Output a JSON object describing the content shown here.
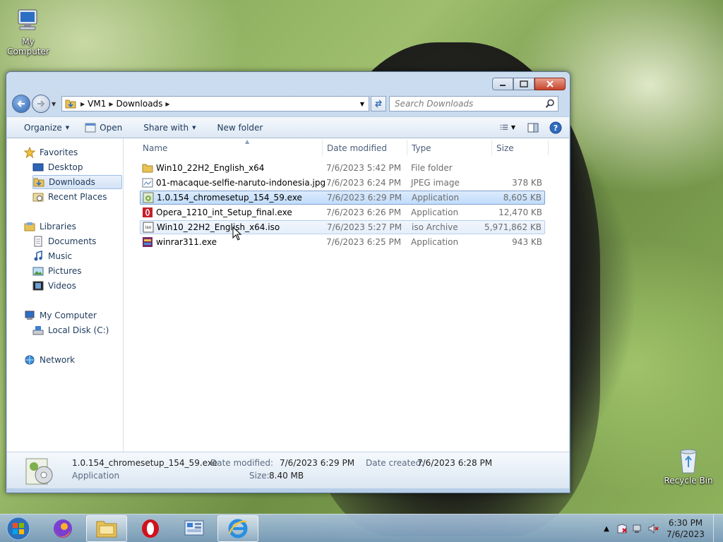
{
  "desktop": {
    "icons": [
      {
        "label": "My Computer"
      },
      {
        "label": "Recycle Bin"
      }
    ]
  },
  "window": {
    "address": {
      "crumbs": [
        "VM1",
        "Downloads"
      ]
    },
    "search_placeholder": "Search Downloads",
    "toolbar": {
      "organize": "Organize",
      "open": "Open",
      "share_with": "Share with",
      "new_folder": "New folder"
    },
    "nav": {
      "favorites": "Favorites",
      "desktop": "Desktop",
      "downloads": "Downloads",
      "recent_places": "Recent Places",
      "libraries": "Libraries",
      "documents": "Documents",
      "music": "Music",
      "pictures": "Pictures",
      "videos": "Videos",
      "my_computer": "My Computer",
      "local_disk": "Local Disk (C:)",
      "network": "Network"
    },
    "columns": {
      "name": "Name",
      "date": "Date modified",
      "type": "Type",
      "size": "Size"
    },
    "files": [
      {
        "name": "Win10_22H2_English_x64",
        "date": "7/6/2023 5:42 PM",
        "type": "File folder",
        "size": ""
      },
      {
        "name": "01-macaque-selfie-naruto-indonesia.jpg",
        "date": "7/6/2023 6:24 PM",
        "type": "JPEG image",
        "size": "378 KB"
      },
      {
        "name": "1.0.154_chromesetup_154_59.exe",
        "date": "7/6/2023 6:29 PM",
        "type": "Application",
        "size": "8,605 KB"
      },
      {
        "name": "Opera_1210_int_Setup_final.exe",
        "date": "7/6/2023 6:26 PM",
        "type": "Application",
        "size": "12,470 KB"
      },
      {
        "name": "Win10_22H2_English_x64.iso",
        "date": "7/6/2023 5:27 PM",
        "type": "iso Archive",
        "size": "5,971,862 KB"
      },
      {
        "name": "winrar311.exe",
        "date": "7/6/2023 6:25 PM",
        "type": "Application",
        "size": "943 KB"
      }
    ],
    "details": {
      "filename": "1.0.154_chromesetup_154_59.exe",
      "type": "Application",
      "date_modified_label": "Date modified:",
      "date_modified": "7/6/2023 6:29 PM",
      "date_created_label": "Date created:",
      "date_created": "7/6/2023 6:28 PM",
      "size_label": "Size:",
      "size": "8.40 MB"
    }
  },
  "taskbar": {
    "time": "6:30 PM",
    "date": "7/6/2023"
  }
}
